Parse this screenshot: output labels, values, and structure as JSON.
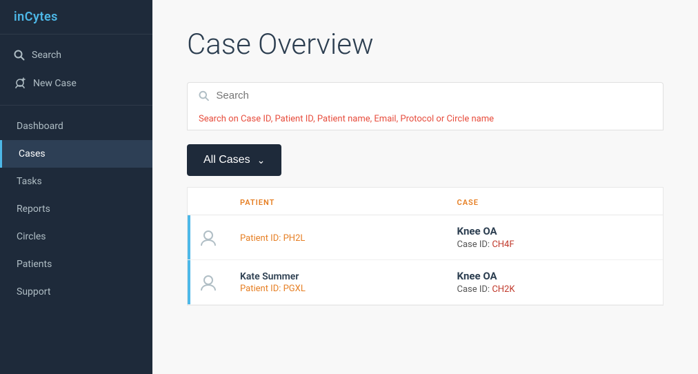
{
  "app": {
    "logo_prefix": "in",
    "logo_suffix": "Cytes"
  },
  "sidebar": {
    "actions": [
      {
        "id": "search",
        "label": "Search",
        "icon": "search-icon"
      },
      {
        "id": "new-case",
        "label": "New Case",
        "icon": "new-case-icon"
      }
    ],
    "nav_items": [
      {
        "id": "dashboard",
        "label": "Dashboard",
        "active": false
      },
      {
        "id": "cases",
        "label": "Cases",
        "active": true
      },
      {
        "id": "tasks",
        "label": "Tasks",
        "active": false
      },
      {
        "id": "reports",
        "label": "Reports",
        "active": false
      },
      {
        "id": "circles",
        "label": "Circles",
        "active": false
      },
      {
        "id": "patients",
        "label": "Patients",
        "active": false
      },
      {
        "id": "support",
        "label": "Support",
        "active": false
      }
    ]
  },
  "main": {
    "page_title": "Case Overview",
    "search": {
      "placeholder": "Search",
      "hint": "Search on Case ID, Patient ID, Patient name, Email, Protocol or Circle name"
    },
    "filter_button": {
      "label": "All Cases"
    },
    "table": {
      "columns": [
        {
          "id": "patient",
          "label": "PATIENT"
        },
        {
          "id": "case",
          "label": "CASE"
        }
      ],
      "rows": [
        {
          "patient_name": "",
          "patient_id": "Patient ID: PH2L",
          "case_name": "Knee OA",
          "case_id_label": "Case ID:",
          "case_id_value": "CH4F"
        },
        {
          "patient_name": "Kate Summer",
          "patient_id": "Patient ID: PGXL",
          "case_name": "Knee OA",
          "case_id_label": "Case ID:",
          "case_id_value": "CH2K"
        }
      ]
    }
  },
  "colors": {
    "accent": "#4db8e8",
    "orange": "#e67e22",
    "red": "#c0392b",
    "dark": "#1e2a3a"
  }
}
